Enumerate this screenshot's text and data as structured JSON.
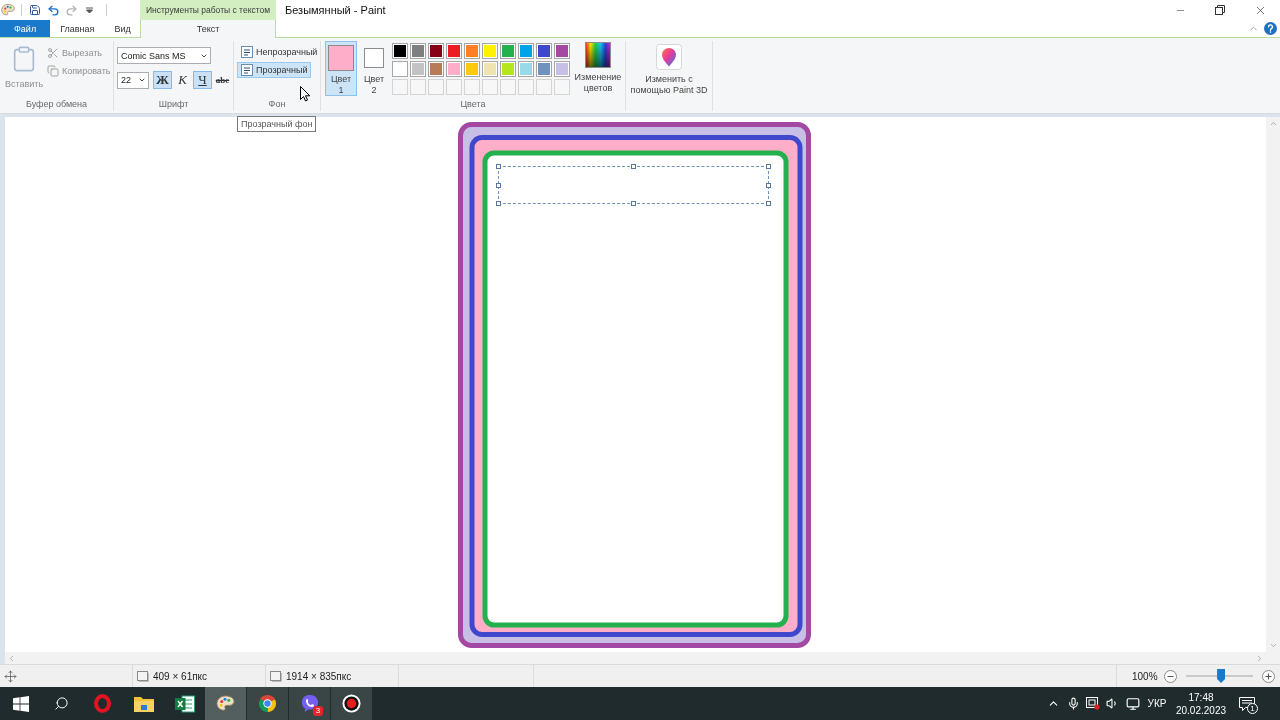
{
  "title_bar": {
    "quick_access": [
      {
        "kind": "save",
        "disabled": false
      },
      {
        "kind": "undo",
        "disabled": false
      },
      {
        "kind": "redo",
        "disabled": true
      },
      {
        "kind": "customize",
        "disabled": false
      }
    ],
    "context_group": "Инструменты работы с текстом",
    "title": "Безымянный - Paint"
  },
  "tabs": [
    {
      "label": "Файл",
      "kind": "file",
      "selected": false
    },
    {
      "label": "Главная",
      "kind": "tab",
      "selected": false
    },
    {
      "label": "Вид",
      "kind": "tab",
      "selected": false
    },
    {
      "label": "Текст",
      "kind": "context",
      "selected": true
    }
  ],
  "clipboard": {
    "label": "Буфер обмена",
    "paste": {
      "label": "Вставить",
      "disabled": true
    },
    "actions": [
      {
        "kind": "cut",
        "label": "Вырезать",
        "disabled": true
      },
      {
        "kind": "copy",
        "label": "Копировать",
        "disabled": true
      }
    ]
  },
  "font": {
    "label": "Шрифт",
    "family": "Comic Sans MS",
    "size": "22",
    "styles": [
      {
        "kind": "bold",
        "label": "Ж",
        "selected": true
      },
      {
        "kind": "italic",
        "label": "К",
        "selected": false
      },
      {
        "kind": "underline",
        "label": "Ч",
        "selected": true
      },
      {
        "kind": "strike",
        "label": "abc",
        "selected": false
      }
    ]
  },
  "background": {
    "label": "Фон",
    "options": [
      {
        "label": "Непрозрачный",
        "selected": false
      },
      {
        "label": "Прозрачный",
        "selected": true
      }
    ]
  },
  "colors": {
    "label": "Цвета",
    "slots": [
      {
        "label": "Цвет 1",
        "color": "#ffaec9",
        "selected": true
      },
      {
        "label": "Цвет 2",
        "color": "#ffffff",
        "selected": false
      }
    ],
    "palette": [
      {
        "kind": "color",
        "color": "#000000"
      },
      {
        "kind": "color",
        "color": "#7f7f7f"
      },
      {
        "kind": "color",
        "color": "#880015"
      },
      {
        "kind": "color",
        "color": "#ed1c24"
      },
      {
        "kind": "color",
        "color": "#ff7f27"
      },
      {
        "kind": "color",
        "color": "#fff200"
      },
      {
        "kind": "color",
        "color": "#22b14c"
      },
      {
        "kind": "color",
        "color": "#00a2e8"
      },
      {
        "kind": "color",
        "color": "#3f48cc"
      },
      {
        "kind": "color",
        "color": "#a349a4"
      },
      {
        "kind": "color",
        "color": "#ffffff"
      },
      {
        "kind": "color",
        "color": "#c3c3c3"
      },
      {
        "kind": "color",
        "color": "#b97a57"
      },
      {
        "kind": "color",
        "color": "#ffaec9"
      },
      {
        "kind": "color",
        "color": "#ffc90e"
      },
      {
        "kind": "color",
        "color": "#efe4b0"
      },
      {
        "kind": "color",
        "color": "#b5e61d"
      },
      {
        "kind": "color",
        "color": "#99d9ea"
      },
      {
        "kind": "color",
        "color": "#7092be"
      },
      {
        "kind": "color",
        "color": "#c8bfe7"
      },
      {
        "kind": "empty"
      },
      {
        "kind": "empty"
      },
      {
        "kind": "empty"
      },
      {
        "kind": "empty"
      },
      {
        "kind": "empty"
      },
      {
        "kind": "empty"
      },
      {
        "kind": "empty"
      },
      {
        "kind": "empty"
      },
      {
        "kind": "empty"
      },
      {
        "kind": "empty"
      }
    ],
    "edit_label": "Изменение цветов"
  },
  "paint3d": {
    "label": "Изменить с помощью Paint 3D"
  },
  "tooltip": "Прозрачный фон",
  "status_bar": {
    "selection_size": "409 × 61пкс",
    "canvas_size": "1914 × 835пкс",
    "zoom": "100%",
    "zoom_slider": {
      "level": 0.5
    }
  },
  "taskbar": {
    "apps": [
      {
        "kind": "start",
        "selected": false,
        "running": false
      },
      {
        "kind": "search",
        "selected": false,
        "running": false
      },
      {
        "kind": "opera",
        "selected": false,
        "running": false
      },
      {
        "kind": "explorer",
        "selected": false,
        "running": false
      },
      {
        "kind": "excel",
        "selected": false,
        "running": false
      },
      {
        "kind": "paint",
        "selected": true,
        "running": true
      },
      {
        "kind": "chrome",
        "selected": false,
        "running": true
      },
      {
        "kind": "viber",
        "selected": false,
        "running": true,
        "badge": "3"
      },
      {
        "kind": "bandicam",
        "selected": false,
        "running": true
      }
    ],
    "tray": {
      "language": "УКР",
      "time": "17:48",
      "date": "20.02.2023",
      "notifications": "1"
    }
  }
}
